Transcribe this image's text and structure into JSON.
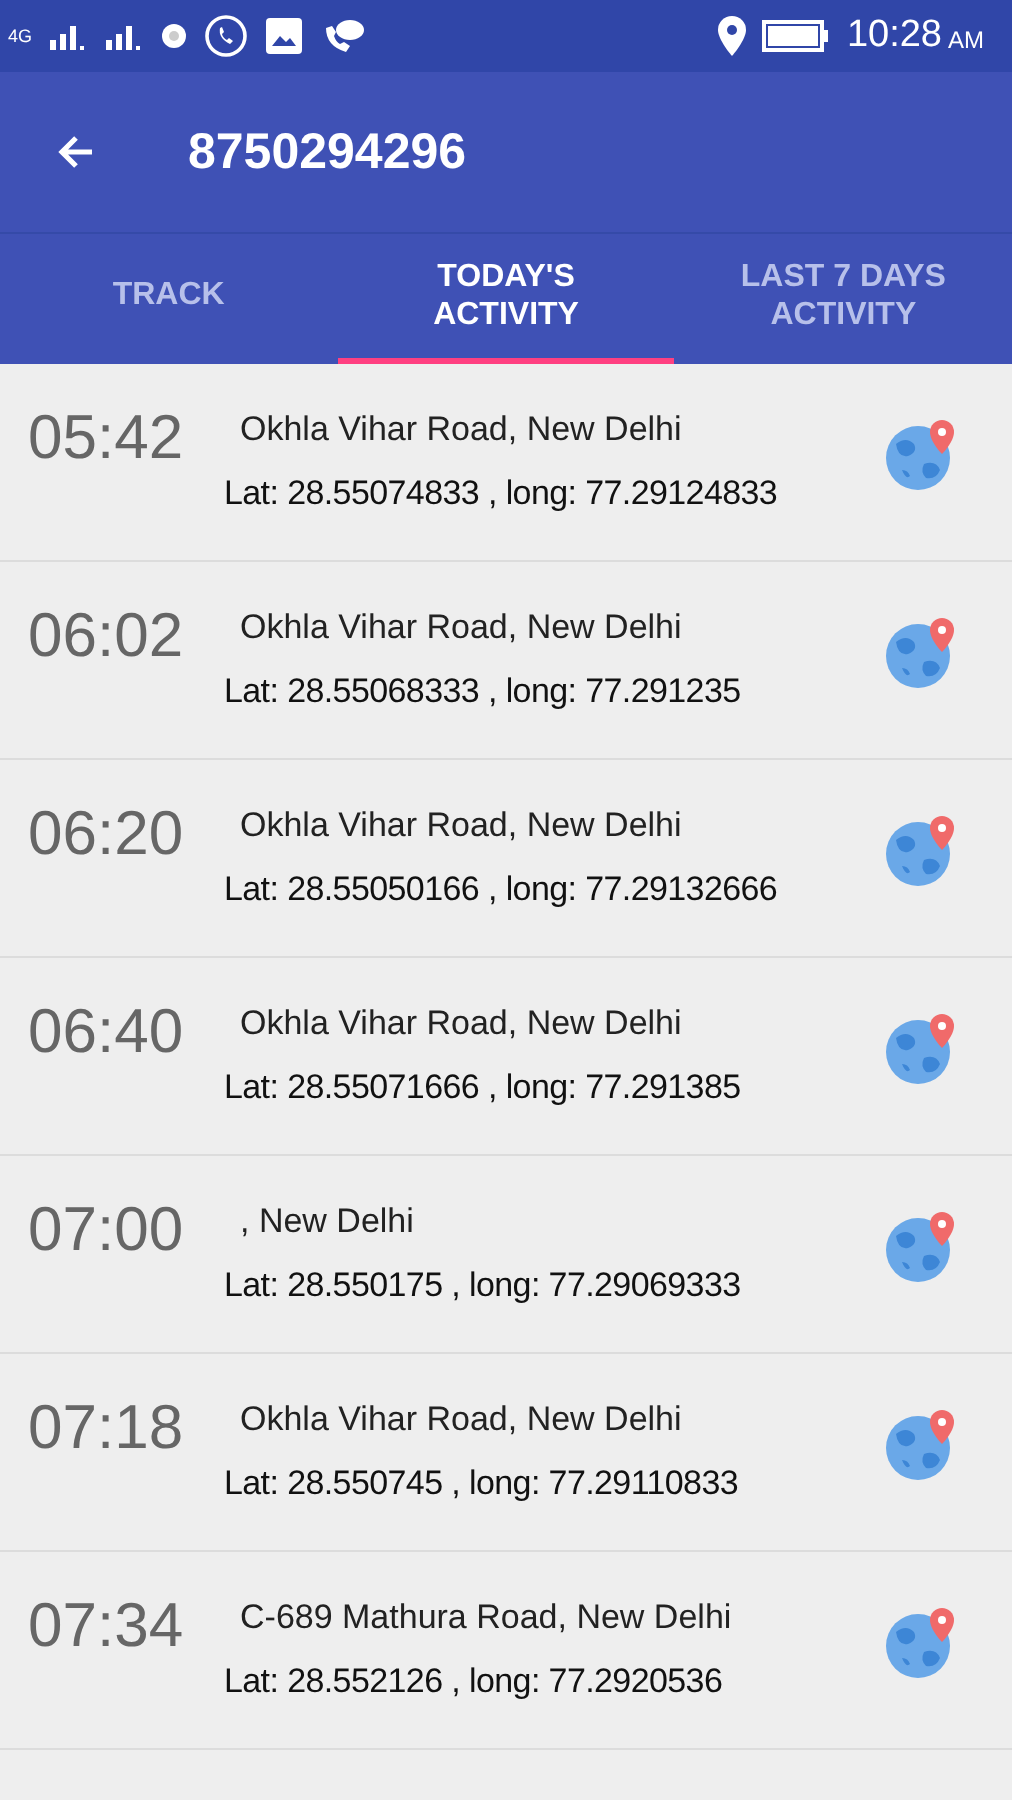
{
  "status_bar": {
    "network": "4G",
    "time": "10:28",
    "meridiem": "AM"
  },
  "app_bar": {
    "title": "8750294296"
  },
  "tabs": [
    {
      "label": "TRACK",
      "selected": false
    },
    {
      "label": "TODAY'S ACTIVITY",
      "selected": true
    },
    {
      "label": "LAST 7 DAYS ACTIVITY",
      "selected": false
    }
  ],
  "entries": [
    {
      "time": "05:42",
      "address": "Okhla Vihar Road, New Delhi",
      "coords": "Lat: 28.55074833 , long: 77.29124833"
    },
    {
      "time": "06:02",
      "address": "Okhla Vihar Road, New Delhi",
      "coords": "Lat: 28.55068333 , long: 77.291235"
    },
    {
      "time": "06:20",
      "address": "Okhla Vihar Road, New Delhi",
      "coords": "Lat: 28.55050166 , long: 77.29132666"
    },
    {
      "time": "06:40",
      "address": "Okhla Vihar Road, New Delhi",
      "coords": "Lat: 28.55071666 , long: 77.291385"
    },
    {
      "time": "07:00",
      "address": ", New Delhi",
      "coords": "Lat: 28.550175 , long: 77.29069333"
    },
    {
      "time": "07:18",
      "address": "Okhla Vihar Road, New Delhi",
      "coords": "Lat: 28.550745 , long: 77.29110833"
    },
    {
      "time": "07:34",
      "address": "C-689 Mathura Road, New Delhi",
      "coords": "Lat: 28.552126 , long: 77.2920536"
    }
  ]
}
